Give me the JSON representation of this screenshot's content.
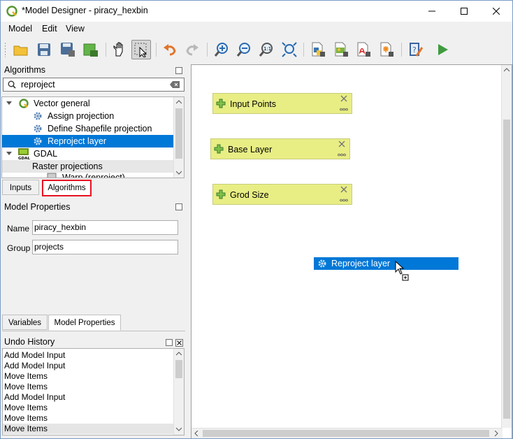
{
  "window": {
    "title": "*Model Designer - piracy_hexbin",
    "minimize_icon": "minimize-icon",
    "maximize_icon": "maximize-icon",
    "close_icon": "close-icon"
  },
  "menu": {
    "items": [
      "Model",
      "Edit",
      "View"
    ]
  },
  "toolbar": {
    "buttons": [
      {
        "name": "open-model-icon"
      },
      {
        "name": "save-model-icon"
      },
      {
        "name": "save-as-icon"
      },
      {
        "name": "save-in-project-icon"
      },
      {
        "name": "pan-icon"
      },
      {
        "name": "select-icon"
      },
      {
        "name": "undo-icon"
      },
      {
        "name": "redo-icon"
      },
      {
        "name": "zoom-in-icon"
      },
      {
        "name": "zoom-out-icon"
      },
      {
        "name": "zoom-actual-icon"
      },
      {
        "name": "zoom-full-icon"
      },
      {
        "name": "export-python-icon"
      },
      {
        "name": "export-image-icon"
      },
      {
        "name": "export-pdf-icon"
      },
      {
        "name": "export-svg-icon"
      },
      {
        "name": "edit-help-icon"
      },
      {
        "name": "run-model-icon"
      }
    ]
  },
  "algorithms_panel": {
    "title": "Algorithms",
    "search_value": "reproject",
    "tree": [
      {
        "label": "Vector general",
        "level": 0,
        "expanded": true
      },
      {
        "label": "Assign projection",
        "level": 1
      },
      {
        "label": "Define Shapefile projection",
        "level": 1
      },
      {
        "label": "Reproject layer",
        "level": 1,
        "selected": true
      },
      {
        "label": "GDAL",
        "level": 0,
        "expanded": true
      },
      {
        "label": "Raster projections",
        "level": 1,
        "group": true
      },
      {
        "label": "Warp (reproject)",
        "level": 2
      }
    ],
    "tabs": [
      "Inputs",
      "Algorithms"
    ]
  },
  "model_properties": {
    "title": "Model Properties",
    "name_label": "Name",
    "name_value": "piracy_hexbin",
    "group_label": "Group",
    "group_value": "projects",
    "tabs": [
      "Variables",
      "Model Properties"
    ]
  },
  "undo_history": {
    "title": "Undo History",
    "items": [
      "Add Model Input",
      "Add Model Input",
      "Move Items",
      "Move Items",
      "Add Model Input",
      "Move Items",
      "Move Items",
      "Move Items"
    ]
  },
  "canvas": {
    "nodes": [
      "Input Points",
      "Base Layer",
      "Grod Size"
    ],
    "dragged_item": "Reproject layer"
  },
  "colors": {
    "selection": "#0078d7",
    "node_fill": "#e8ee84",
    "highlight_box": "#e81123"
  }
}
